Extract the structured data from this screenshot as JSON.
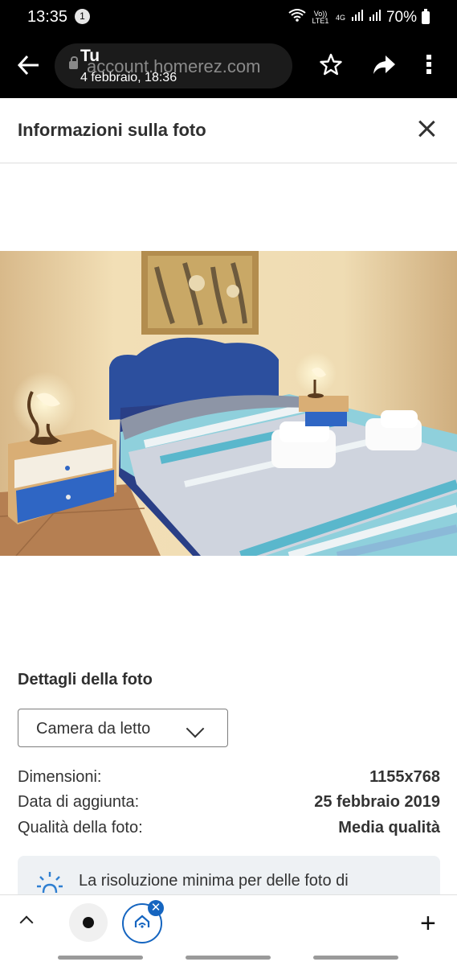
{
  "status_bar": {
    "time": "13:35",
    "notification_count": "1",
    "volte": "Vo)) LTE1",
    "network": "4G",
    "battery": "70%"
  },
  "browser": {
    "url": "account.homerez.com",
    "tab_title": "Tu",
    "tab_date": "4 febbraio, 18:36"
  },
  "panel": {
    "title": "Informazioni sulla foto"
  },
  "details": {
    "section_title": "Dettagli della foto",
    "room_type_selected": "Camera da letto",
    "rows": [
      {
        "key": "Dimensioni:",
        "value": "1155x768"
      },
      {
        "key": "Data di aggiunta:",
        "value": "25 febbraio 2019"
      },
      {
        "key": "Qualità della foto:",
        "value": "Media qualità"
      }
    ],
    "notice": "La risoluzione minima per delle foto di"
  },
  "bottom_bar": {
    "tab_badge": "✕",
    "plus": "+"
  },
  "colors": {
    "accent": "#1565c0",
    "toolbar": "#000000",
    "notice_bg": "#eef1f4"
  }
}
